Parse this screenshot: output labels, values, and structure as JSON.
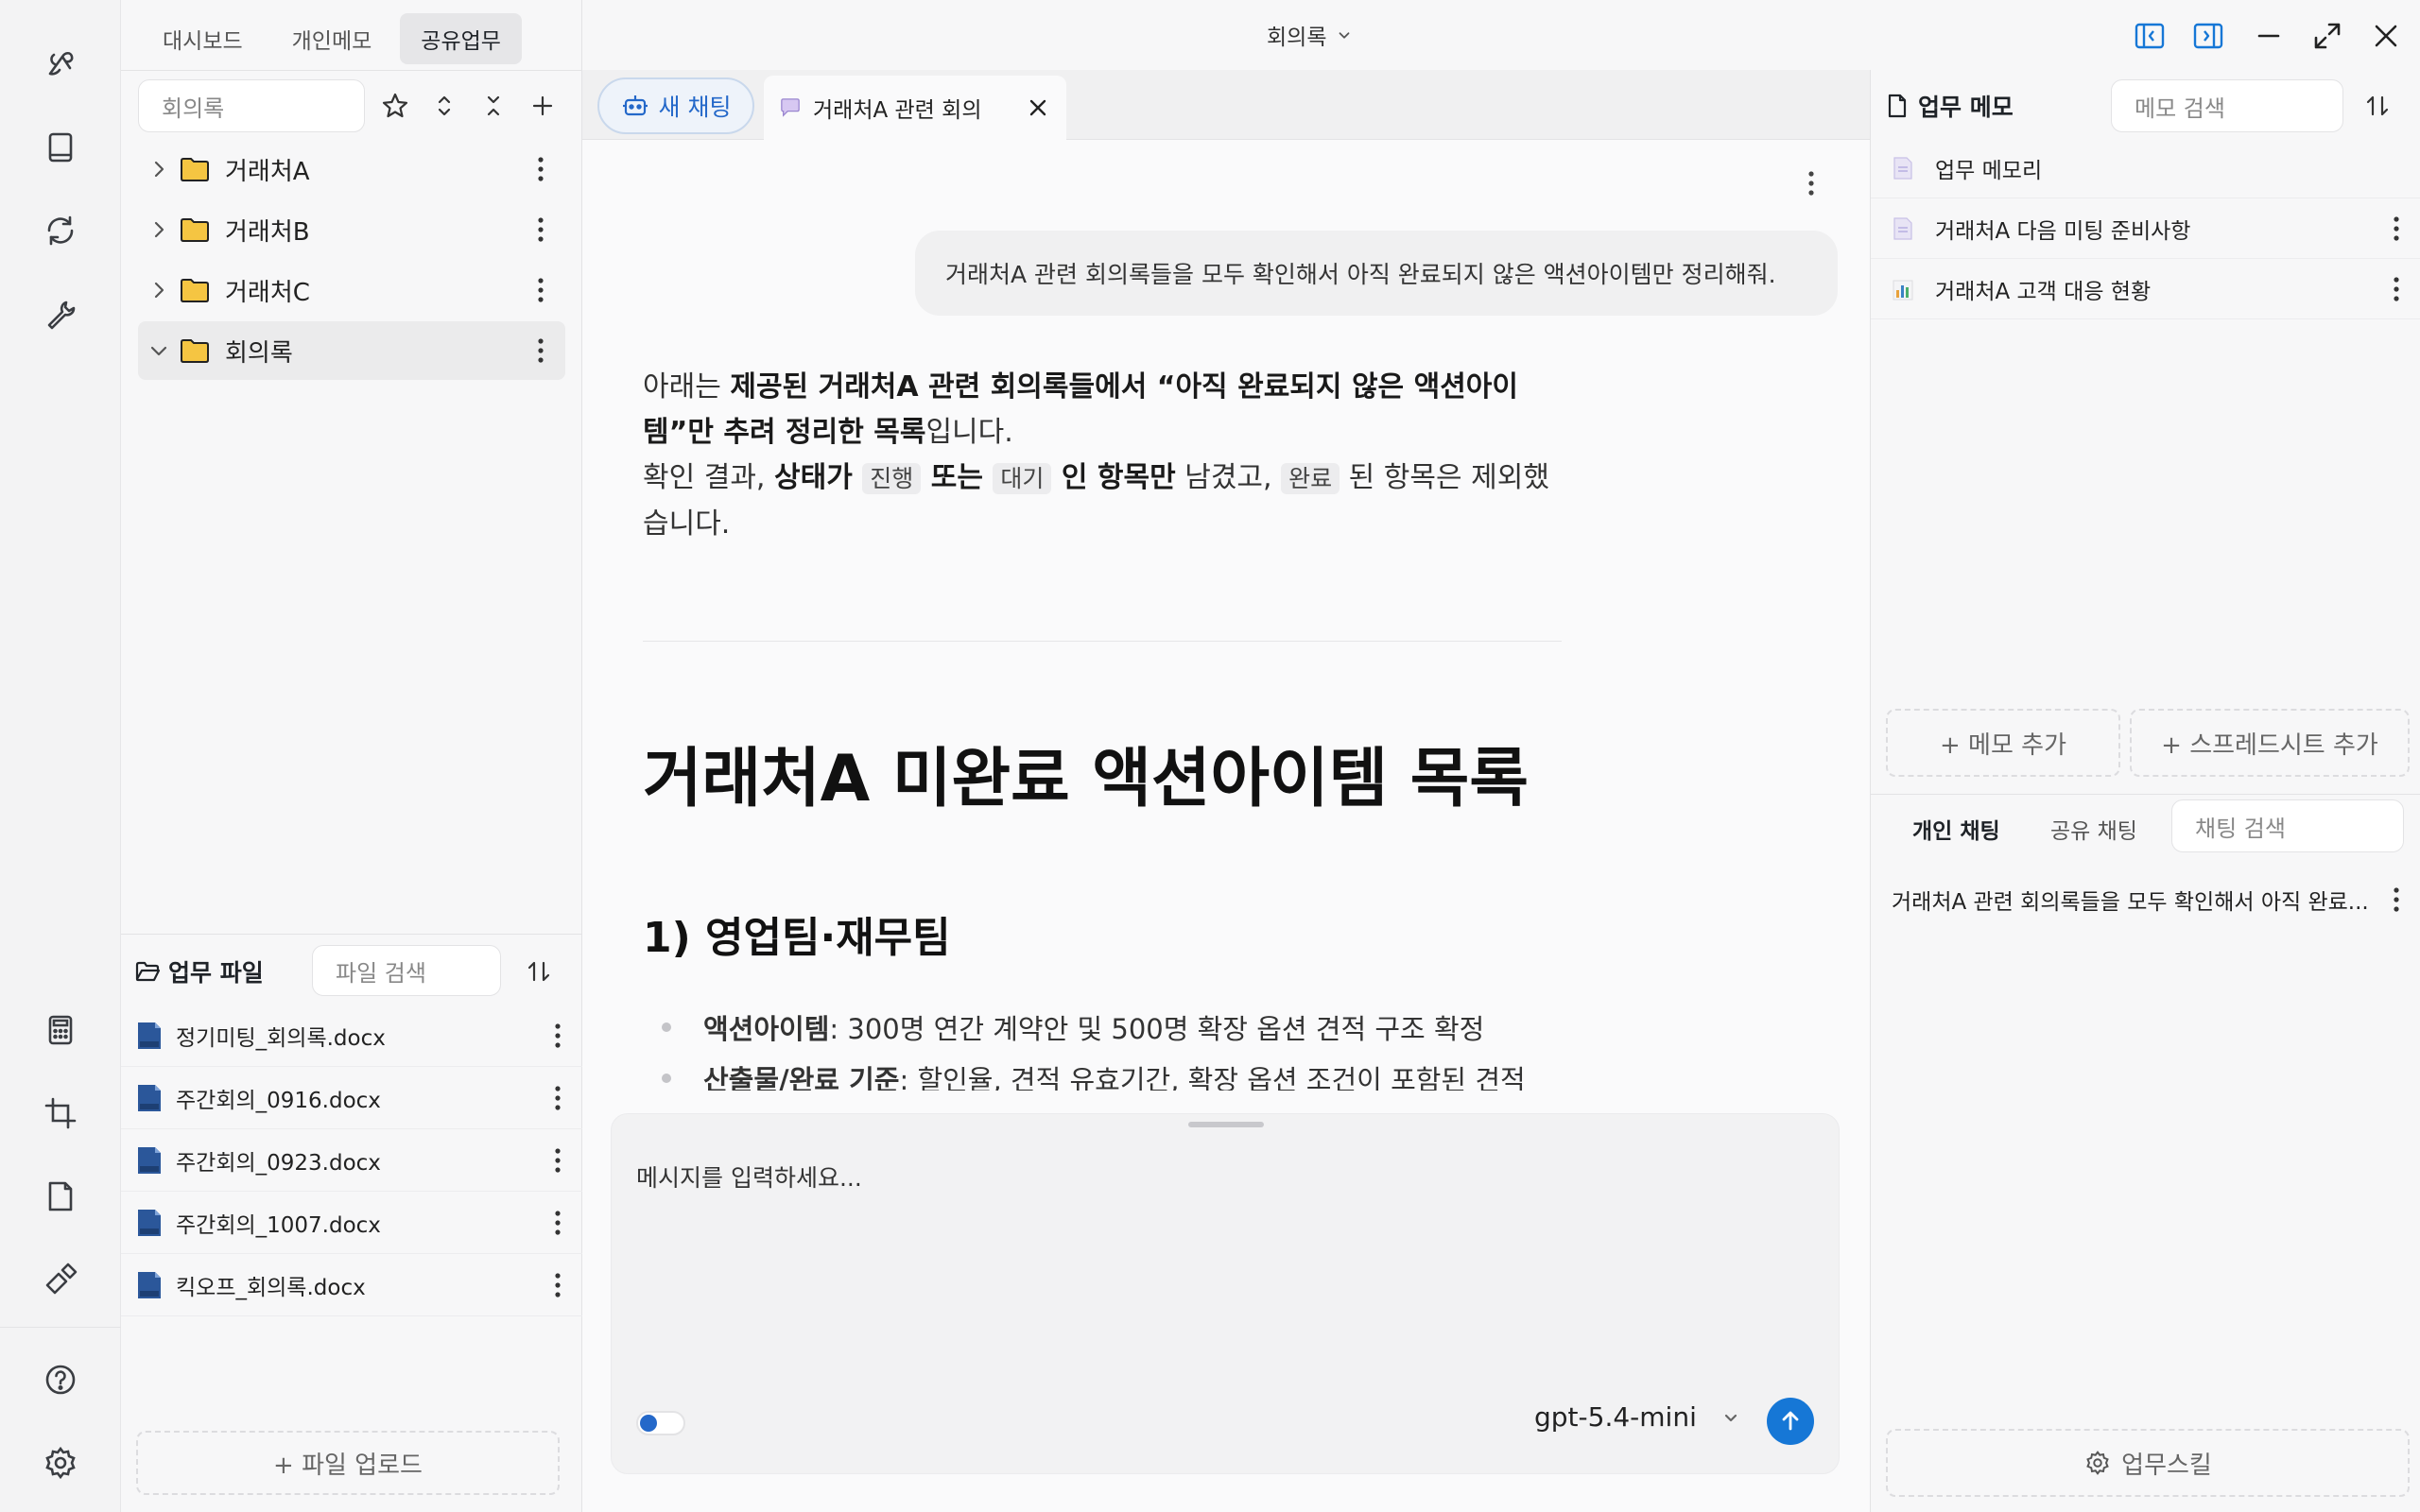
{
  "app": {
    "tabs": [
      "대시보드",
      "개인메모",
      "공유업무"
    ],
    "active_tab": "공유업무",
    "window_title": "회의록"
  },
  "left": {
    "search_placeholder": "회의록",
    "tree": [
      {
        "label": "거래처A",
        "expanded": false
      },
      {
        "label": "거래처B",
        "expanded": false
      },
      {
        "label": "거래처C",
        "expanded": false
      },
      {
        "label": "회의록",
        "expanded": true,
        "selected": true
      }
    ],
    "files_title": "업무 파일",
    "files_search_placeholder": "파일 검색",
    "files": [
      "정기미팅_회의록.docx",
      "주간회의_0916.docx",
      "주간회의_0923.docx",
      "주간회의_1007.docx",
      "킥오프_회의록.docx"
    ],
    "upload_label": "+ 파일 업로드"
  },
  "center": {
    "new_chat_label": "새 채팅",
    "chat_tab_label": "거래처A 관련 회의",
    "user_message": "거래처A 관련 회의록들을 모두 확인해서 아직 완료되지 않은 액션아이템만 정리해줘.",
    "answer": {
      "p1_pre": "아래는 ",
      "p1_bold": "제공된 거래처A 관련 회의록들에서 “아직 완료되지 않은 액션아이템”만 추려 정리한 목록",
      "p1_post": "입니다.",
      "p2_pre": "확인 결과, ",
      "p2_bold1": "상태가 ",
      "code1": "진행",
      "p2_bold2": " 또는 ",
      "code2": "대기",
      "p2_bold3": " 인 항목만",
      "p2_mid": " 남겼고, ",
      "code3": "완료",
      "p2_post": " 된 항목은 제외했습니다."
    },
    "heading1": "거래처A 미완료 액션아이템 목록",
    "heading2": "1) 영업팀·재무팀",
    "bullets": [
      {
        "label": "액션아이템",
        "text": ": 300명 연간 계약안 및 500명 확장 옵션 견적 구조 확정"
      },
      {
        "label": "산출물/완료 기준",
        "text": ": 할인율, 견적 유효기간, 확장 옵션 조건이 포함된 견적"
      }
    ],
    "input_placeholder": "메시지를 입력하세요...",
    "model": "gpt-5.4-mini"
  },
  "right": {
    "memo_title": "업무 메모",
    "memo_search_placeholder": "메모 검색",
    "memos": [
      {
        "label": "업무 메모리",
        "kind": "doc"
      },
      {
        "label": "거래처A 다음 미팅 준비사항",
        "kind": "doc"
      },
      {
        "label": "거래처A 고객 대응 현황",
        "kind": "sheet"
      }
    ],
    "add_memo_label": "+ 메모 추가",
    "add_sheet_label": "+ 스프레드시트 추가",
    "chat_tabs": [
      "개인 채팅",
      "공유 채팅"
    ],
    "chat_search_placeholder": "채팅 검색",
    "chat_items": [
      "거래처A 관련 회의록들을 모두 확인해서 아직 완료..."
    ],
    "skill_label": "업무스킬"
  },
  "colors": {
    "accent": "#1677d6",
    "folder": "#f5c542"
  }
}
